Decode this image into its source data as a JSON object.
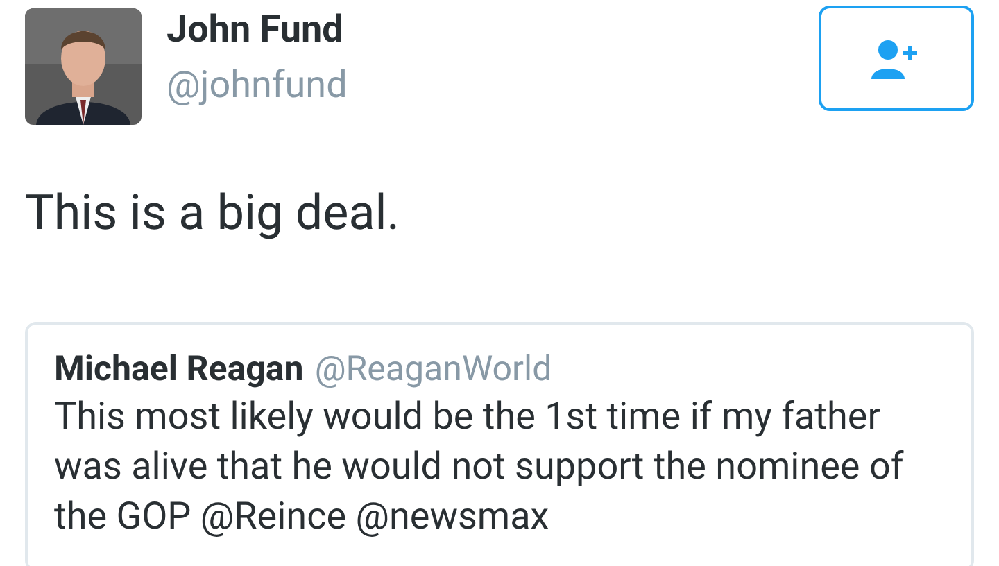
{
  "author": {
    "name": "John Fund",
    "handle": "@johnfund"
  },
  "follow_button": {
    "selected": false
  },
  "tweet_text": "This is a big deal.",
  "quoted_tweet": {
    "name": "Michael Reagan",
    "handle": "@ReaganWorld",
    "text": "This most likely would be the 1st time if my father was alive that he would not support the nominee of the GOP @Reince @newsmax"
  }
}
